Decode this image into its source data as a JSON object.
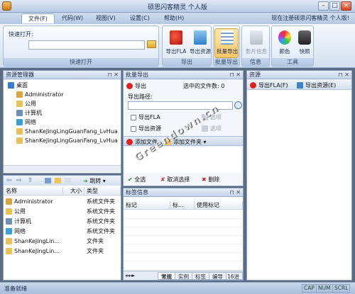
{
  "window": {
    "title": "硕思闪客精灵 个人版",
    "registration": "现在注册硕思闪客精灵 个人版!"
  },
  "menu": [
    "文件(F)",
    "代码(W)",
    "视图(V)",
    "设置(C)",
    "帮助(H)"
  ],
  "ribbon": {
    "quick_open_label": "快速打开:",
    "quick_open_group": "快速打开",
    "export_group": "导出",
    "batch_group": "批量导出",
    "info_group": "信息",
    "tools_group": "工具",
    "buttons": [
      "导出FLA",
      "导出资源",
      "批量导出",
      "影片信息",
      "颜色",
      "快照"
    ]
  },
  "explorer": {
    "title": "资源管理器",
    "tree": [
      "桌面",
      "Administrator",
      "公用",
      "计算机",
      "网络",
      "ShanKeJingLingGuanFang_LvHua",
      "ShanKeJingLingGuanFang_LvHua"
    ],
    "nav_label": "跳转",
    "columns": [
      "名称",
      "大小",
      "类型"
    ],
    "files": [
      {
        "name": "Administrator",
        "size": "",
        "type": "系统文件夹"
      },
      {
        "name": "公用",
        "size": "",
        "type": "系统文件夹"
      },
      {
        "name": "计算机",
        "size": "",
        "type": "系统文件夹"
      },
      {
        "name": "网络",
        "size": "",
        "type": "系统文件夹"
      },
      {
        "name": "ShanKeJingLin...",
        "size": "",
        "type": "文件夹"
      },
      {
        "name": "ShanKeJingLin...",
        "size": "",
        "type": "文件夹"
      }
    ]
  },
  "batch": {
    "title": "批量导出",
    "export_label": "导出",
    "selected_label": "选中的文件数:",
    "selected_count": "0",
    "path_label": "导出路径:",
    "path_value": "",
    "export_fla": "导出FLA",
    "export_resources": "导出资源",
    "option1": "选项",
    "option2": "选项",
    "add_file": "添加文件",
    "add_folder": "添加文件夹",
    "select_all": "全选",
    "deselect": "取消选择",
    "delete": "删除"
  },
  "tags": {
    "title": "标签信息",
    "columns": [
      "标记",
      "标...",
      "使用标记"
    ],
    "tabs": [
      "常规",
      "实例",
      "标签",
      "编导",
      "16进制"
    ]
  },
  "resources": {
    "title": "资源",
    "export_fla": "导出FLA(F)",
    "export_resources": "导出资源(E)"
  },
  "watermark": "Greendown.cn",
  "status": {
    "text": "准备就绪",
    "cap": "CAP",
    "num": "NUM",
    "scrl": "SCRL"
  },
  "colors": {
    "accent": "#f7c768",
    "frame": "#8ea3c2"
  }
}
